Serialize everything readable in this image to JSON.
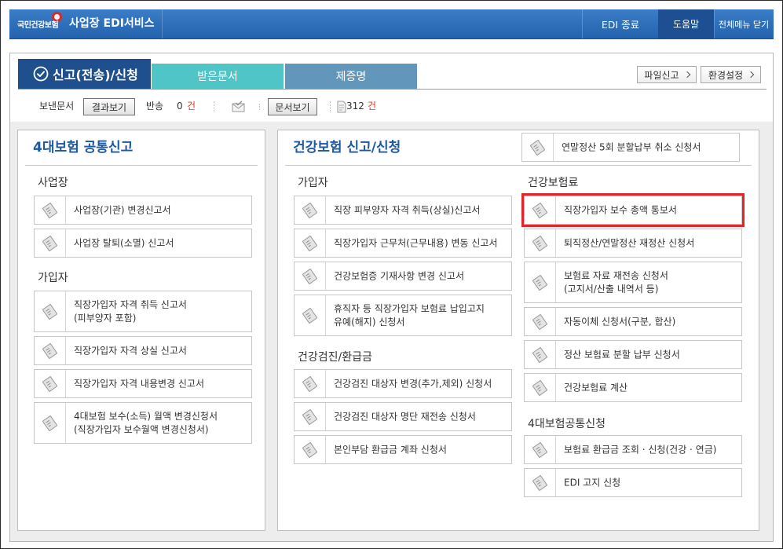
{
  "header": {
    "logo_text": "국민건강보험",
    "service_title": "사업장 EDI서비스",
    "edi_exit": "EDI 종료",
    "help": "도움말",
    "close_all_menu": "전체메뉴 닫기"
  },
  "tabs": [
    {
      "label": "신고(전송)/신청",
      "active": true,
      "icon": "check-circle-icon"
    },
    {
      "label": "받은문서",
      "active": false
    },
    {
      "label": "제증명",
      "active": false
    }
  ],
  "top_buttons": {
    "file_report": "파일신고",
    "settings": "환경설정",
    "icon": "chevron-right-icon"
  },
  "toolbar": {
    "sent_docs_label": "보낸문서",
    "view_results_button": "결과보기",
    "returned_label": "반송",
    "returned_count": "0",
    "returned_unit": "건",
    "mail_icon": "envelope-icon",
    "view_docs_button": "문서보기",
    "doc_icon": "document-icon",
    "doc_count": "312",
    "doc_unit": "건"
  },
  "item_icon": "edit-document-icon",
  "left_panel": {
    "title": "4대보험 공통신고",
    "sections": [
      {
        "title": "사업장",
        "items": [
          {
            "label": "사업장(기관) 변경신고서"
          },
          {
            "label": "사업장 탈퇴(소멸) 신고서"
          }
        ]
      },
      {
        "title": "가입자",
        "items": [
          {
            "label": "직장가입자 자격 취득 신고서\n(피부양자 포함)"
          },
          {
            "label": "직장가입자 자격 상실 신고서"
          },
          {
            "label": "직장가입자 자격 내용변경 신고서"
          },
          {
            "label": "4대보험 보수(소득) 월액 변경신청서\n(직장가입자 보수월액 변경신청서)"
          }
        ]
      }
    ]
  },
  "right_panel": {
    "title": "건강보험 신고/신청",
    "top_item": {
      "label": "연말정산 5회 분할납부 취소 신청서"
    },
    "left_sections": [
      {
        "title": "가입자",
        "items": [
          {
            "label": "직장 피부양자 자격 취득(상실)신고서"
          },
          {
            "label": "직장가입자 근무처(근무내용) 변동 신고서"
          },
          {
            "label": "건강보험증 기재사항 변경 신고서"
          },
          {
            "label": "휴직자 등 직장가입자 보험료 납입고지\n유예(해지) 신청서"
          }
        ]
      },
      {
        "title": "건강검진/환급금",
        "items": [
          {
            "label": "건강검진 대상자 변경(추가,제외) 신청서"
          },
          {
            "label": "건강검진 대상자 명단 재전송 신청서"
          },
          {
            "label": "본인부담 환급금 계좌 신청서"
          }
        ]
      }
    ],
    "right_sections": [
      {
        "title": "건강보험료",
        "items": [
          {
            "label": "직장가입자 보수 총액 통보서",
            "highlighted": true
          },
          {
            "label": "퇴직정산/연말정산 재정산 신청서"
          },
          {
            "label": "보험료 자료 재전송 신청서\n(고지서/산출 내역서 등)"
          },
          {
            "label": "자동이체 신청서(구분, 합산)"
          },
          {
            "label": "정산 보험료 분할 납부 신청서"
          },
          {
            "label": "건강보험료 계산"
          }
        ]
      },
      {
        "title": "4대보험공통신청",
        "items": [
          {
            "label": "보험료 환급금 조회 · 신청(건강 · 연금)"
          },
          {
            "label": "EDI 고지 신청"
          }
        ]
      }
    ]
  },
  "colors": {
    "header_blue": "#2c6cb8",
    "active_tab": "#1f4f8d",
    "received_tab": "#4fc5c8",
    "certificate_tab": "#6297bb",
    "title_blue": "#1b59a4",
    "highlight_red": "#e0262b",
    "count_red": "#e3362b"
  }
}
